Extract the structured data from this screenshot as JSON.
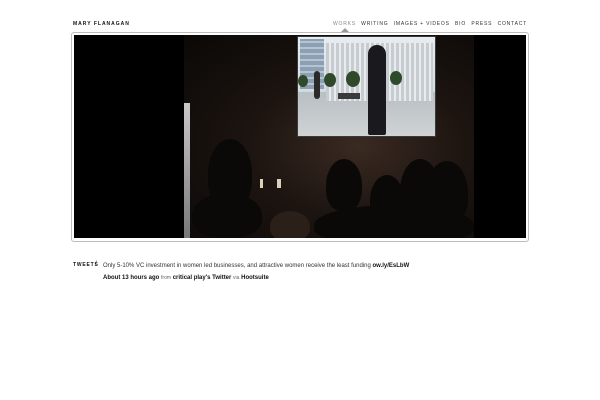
{
  "site": {
    "logo": "Mary Flanagan"
  },
  "nav": {
    "items": [
      "Works",
      "Writing",
      "Images + Videos",
      "Bio",
      "Press",
      "Contact"
    ],
    "active": "Works"
  },
  "media": {
    "icon": "video-still"
  },
  "tweets": {
    "label": "Tweets",
    "separator": "/",
    "text": "Only 5-10% VC investment in women led businesses, and attractive women receive the least funding",
    "link": "ow.ly/EsLbW",
    "time": "About 13 hours ago",
    "from_word": "from",
    "source": "critical play's Twitter",
    "via_word": "via",
    "client": "Hootsuite"
  },
  "colors": {
    "background": "#ffffff",
    "frame_border": "#bdbdbd",
    "video_bg": "#000000"
  }
}
